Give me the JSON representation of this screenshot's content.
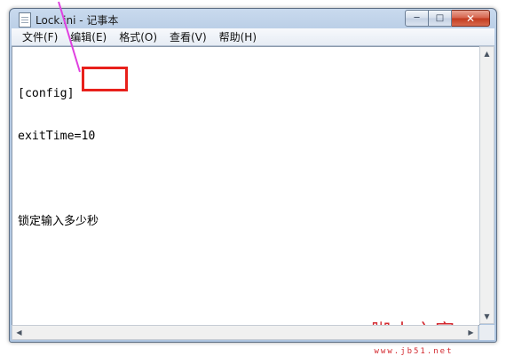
{
  "window": {
    "title": "Lock.ini - 记事本",
    "controls": {
      "minimize": "─",
      "maximize": "□",
      "close": "✕"
    }
  },
  "menu": {
    "items": [
      {
        "label": "文件(F)"
      },
      {
        "label": "编辑(E)"
      },
      {
        "label": "格式(O)"
      },
      {
        "label": "查看(V)"
      },
      {
        "label": "帮助(H)"
      }
    ]
  },
  "editor": {
    "lines": [
      "[config]",
      "exitTime=10",
      "",
      "锁定输入多少秒"
    ]
  },
  "scrollbars": {
    "up_arrow": "▲",
    "down_arrow": "▼",
    "left_arrow": "◀",
    "right_arrow": "▶"
  },
  "watermark": {
    "title": "脚本之家",
    "url": "www.jb51.net"
  },
  "colors": {
    "annotation_red": "#e8201b",
    "pointer_magenta": "#e040e0",
    "watermark_red": "#d3292f"
  }
}
